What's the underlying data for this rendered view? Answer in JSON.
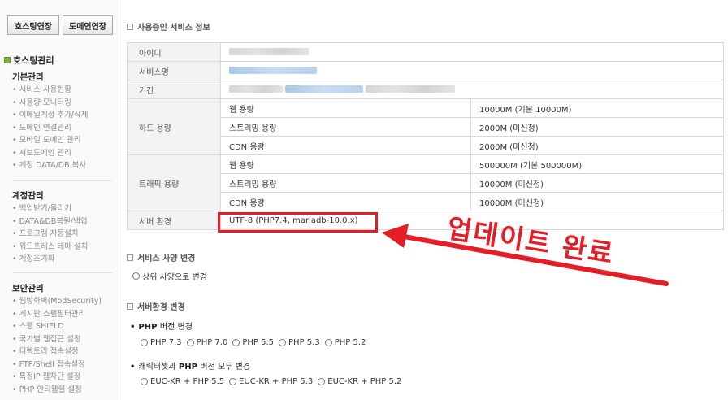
{
  "sidebar": {
    "top_buttons": [
      "호스팅연장",
      "도메인연장"
    ],
    "header": "호스팅관리",
    "sections": [
      {
        "title": "기본관리",
        "items": [
          "서비스 사용현황",
          "사용량 모니터링",
          "이메일계정 추가/삭제",
          "도메인 연결관리",
          "모바일 도메인 관리",
          "서브도메인 관리",
          "계정 DATA/DB 복사"
        ]
      },
      {
        "title": "계정관리",
        "items": [
          "백업받기/올리기",
          "DATA&DB복원/백업",
          "프로그램 자동설치",
          "워드프레스 테마 설치",
          "계정초기화"
        ]
      },
      {
        "title": "보안관리",
        "items": [
          "웹방화벽(ModSecurity)",
          "게시판 스팸필터관리",
          "스팸 SHIELD",
          "국가별 웹접근 설정",
          "디렉토리 접속설정",
          "FTP/Shell 접속설정",
          "특정IP 웹차단 설정",
          "PHP 안티웹쉘 설정"
        ]
      }
    ]
  },
  "service_info": {
    "heading": "사용중인 서비스 정보",
    "rows": {
      "id_label": "아이디",
      "service_label": "서비스명",
      "period_label": "기간",
      "disk_label": "하드 용량",
      "disk": [
        {
          "name": "웹 용량",
          "value": "10000M (기본 10000M)"
        },
        {
          "name": "스트리밍 용량",
          "value": "2000M (미신청)"
        },
        {
          "name": "CDN 용량",
          "value": "2000M (미신청)"
        }
      ],
      "traffic_label": "트래픽 용량",
      "traffic": [
        {
          "name": "웹 용량",
          "value": "500000M (기본 500000M)"
        },
        {
          "name": "스트리밍 용량",
          "value": "10000M (미신청)"
        },
        {
          "name": "CDN 용량",
          "value": "10000M (미신청)"
        }
      ],
      "env_label": "서버 환경",
      "env_value": "UTF-8 (PHP7.4, mariadb-10.0.x)"
    }
  },
  "annotation": {
    "text": "업데이트 완료",
    "color": "#e41e26"
  },
  "spec_change": {
    "heading": "서비스 사양 변경",
    "option": "상위 사양으로 변경"
  },
  "env_change": {
    "heading": "서버환경 변경",
    "php_title_bold": "PHP",
    "php_title_rest": "버전 변경",
    "php_options": [
      "PHP 7.3",
      "PHP 7.0",
      "PHP 5.5",
      "PHP 5.3",
      "PHP 5.2"
    ],
    "charset_title_pre": "캐릭터셋과",
    "charset_title_bold": "PHP",
    "charset_title_rest": "버전 모두 변경",
    "charset_options": [
      "EUC-KR + PHP 5.5",
      "EUC-KR + PHP 5.3",
      "EUC-KR + PHP 5.2"
    ]
  },
  "colors": {
    "accent": "#7db338",
    "highlight": "#e41e26"
  }
}
